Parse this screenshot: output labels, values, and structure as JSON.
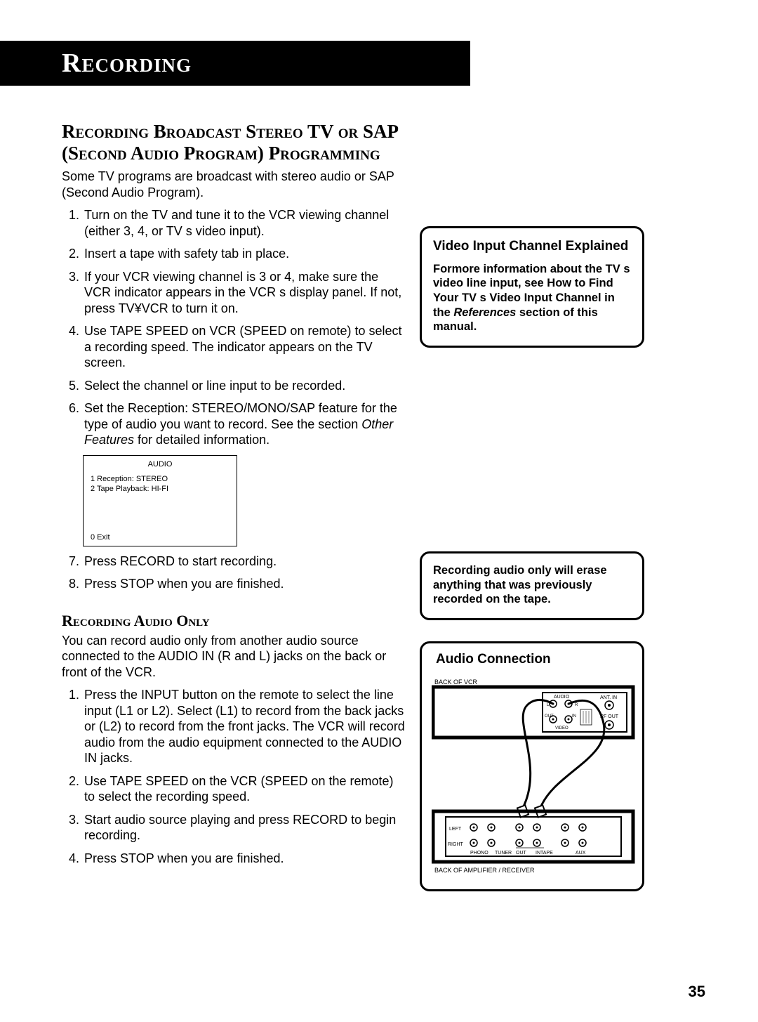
{
  "header": {
    "title": "Recording"
  },
  "section1": {
    "title": "Recording Broadcast Stereo TV or SAP (Second Audio Program) Programming",
    "intro": "Some TV programs are broadcast with stereo audio or SAP (Second Audio Program).",
    "steps": [
      "Turn on the TV and tune it to the VCR viewing channel (either 3, 4, or TV s video input).",
      "Insert a tape with safety tab in place.",
      "If your VCR viewing channel is 3 or 4, make sure the VCR indicator appears in the VCR s display panel. If not, press TV¥VCR to turn it on.",
      "Use TAPE SPEED on VCR (SPEED on remote) to select a recording speed. The indicator appears on the TV screen.",
      "Select the channel or line input to be recorded."
    ],
    "step6_a": "Set the Reception: STEREO/MONO/SAP feature for the type of audio you want to record. See the section ",
    "step6_b": "Other Features",
    "step6_c": " for detailed information.",
    "osd": {
      "title": "AUDIO",
      "line1": "1 Reception:    STEREO",
      "line2": "2 Tape Playback: HI-FI",
      "exit": "0 Exit"
    },
    "steps_after": [
      "Press RECORD to start recording.",
      "Press STOP when you are finished."
    ]
  },
  "section2": {
    "title": "Recording Audio Only",
    "intro": "You can record audio only from another audio source connected to the AUDIO IN (R and L) jacks on the back or front of the VCR.",
    "steps": [
      "Press the INPUT button on the remote to select the line input (L1 or L2). Select (L1) to record from the back jacks or (L2) to record from the front jacks. The VCR will record audio from the audio equipment connected to the AUDIO IN jacks.",
      "Use TAPE SPEED on the VCR (SPEED on the remote) to select the recording speed.",
      "Start audio source playing and press RECORD to begin recording.",
      "Press STOP when you are finished."
    ]
  },
  "callout1": {
    "title": "Video Input Channel Explained",
    "text_a": "Formore information about the TV s video line input, see  How to Find Your TV s Video Input Channel  in the ",
    "text_b": "References",
    "text_c": " section of this manual."
  },
  "callout2": {
    "text": "Recording audio only will erase anything that was previously recorded on the tape."
  },
  "diagram": {
    "title": "Audio Connection",
    "label_vcr": "BACK OF VCR",
    "label_amp": "BACK OF AMPLIFIER / RECEIVER",
    "audio": "AUDIO",
    "ant_in": "ANT. IN",
    "rf_out": "RF OUT",
    "video": "VIDEO",
    "out": "OUT",
    "in": "IN",
    "l": "L",
    "r": "R",
    "left": "LEFT",
    "right": "RIGHT",
    "phono": "PHONO",
    "tuner": "TUNER",
    "tape": "TAPE",
    "aux": "AUX"
  },
  "page": "35"
}
